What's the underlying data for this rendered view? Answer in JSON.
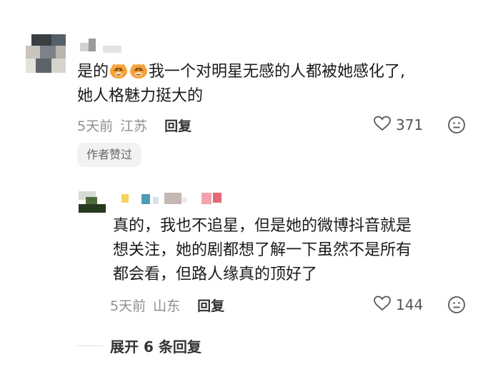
{
  "comment1": {
    "text_before_emoji": "是的",
    "emojis": [
      "tiger-emoji",
      "tiger-emoji"
    ],
    "text_after_emoji": "我一个对明星无感的人都被她感化了,",
    "text_line2": "她人格魅力挺大的",
    "time": "5天前",
    "location": "江苏",
    "reply_label": "回复",
    "likes": "371",
    "badge": "作者赞过"
  },
  "comment2": {
    "lines": [
      "真的，我也不追星，但是她的微博抖音就是",
      "想关注，她的剧都想了解一下虽然不是所有",
      "都会看，但路人缘真的顶好了"
    ],
    "time": "5天前",
    "location": "山东",
    "reply_label": "回复",
    "likes": "144"
  },
  "expand_replies": "展开 6 条回复"
}
